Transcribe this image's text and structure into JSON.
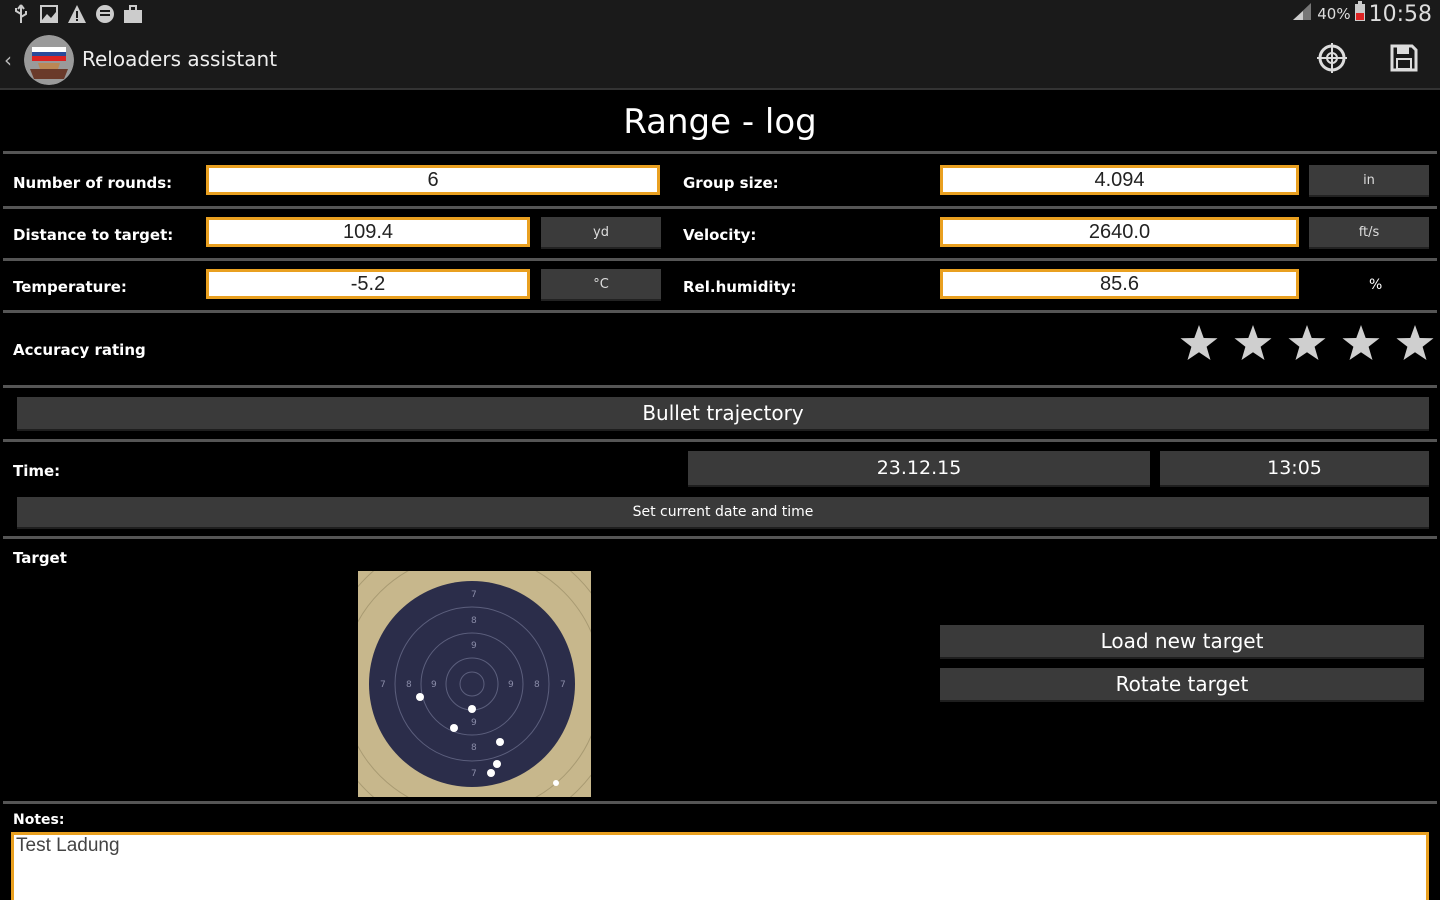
{
  "status_bar": {
    "icons": [
      "usb-icon",
      "image-icon",
      "warning-icon",
      "voicemail-icon",
      "briefcase-icon"
    ],
    "battery": "40%",
    "time": "10:58"
  },
  "action_bar": {
    "title": "Reloaders assistant",
    "actions": [
      "crosshair-icon",
      "save-icon"
    ]
  },
  "page": {
    "title": "Range - log"
  },
  "fields": {
    "rounds_label": "Number of rounds:",
    "rounds_value": "6",
    "group_label": "Group size:",
    "group_value": "4.094",
    "group_unit": "in",
    "distance_label": "Distance to target:",
    "distance_value": "109.4",
    "distance_unit": "yd",
    "velocity_label": "Velocity:",
    "velocity_value": "2640.0",
    "velocity_unit": "ft/s",
    "temperature_label": "Temperature:",
    "temperature_value": "-5.2",
    "temperature_unit": "°C",
    "humidity_label": "Rel.humidity:",
    "humidity_value": "85.6",
    "humidity_unit": "%"
  },
  "rating": {
    "label": "Accuracy rating",
    "max": 5
  },
  "trajectory_button": "Bullet trajectory",
  "time": {
    "label": "Time:",
    "date": "23.12.15",
    "clock": "13:05",
    "set_current": "Set current date and time"
  },
  "target": {
    "label": "Target",
    "ring_labels": [
      "7",
      "8",
      "9"
    ],
    "load_button": "Load new target",
    "rotate_button": "Rotate target"
  },
  "notes": {
    "label": "Notes:",
    "value": "Test Ladung"
  },
  "colors": {
    "background": "#000000",
    "field_border": "#e9a020",
    "button": "#3a3a3a",
    "divider": "#555555"
  }
}
